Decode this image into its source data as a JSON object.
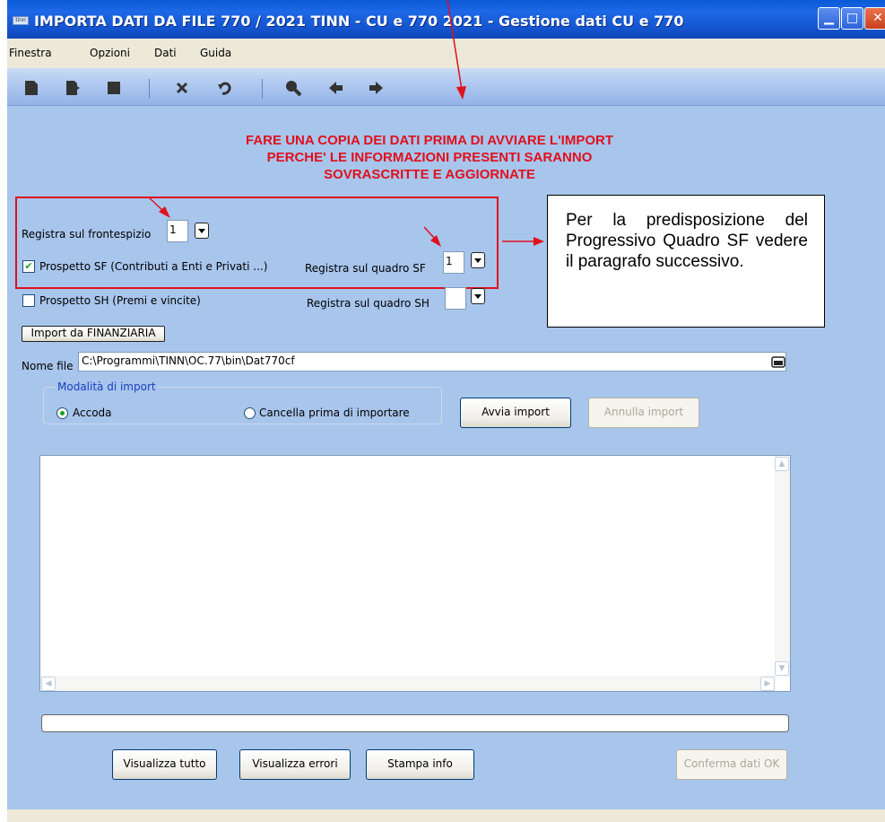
{
  "window": {
    "title": "IMPORTA DATI DA FILE 770 / 2021 TINN - CU e 770 2021 - Gestione dati CU e 770",
    "app_icon_text": "tinn",
    "minimize_glyph": "▁",
    "maximize_glyph": "□",
    "close_glyph": "✕"
  },
  "menu": {
    "items": [
      "Finestra",
      "Opzioni",
      "Dati",
      "Guida"
    ]
  },
  "toolbar": {
    "icons": [
      "new-icon",
      "open-icon",
      "save-icon",
      "delete-icon",
      "undo-icon",
      "search-icon",
      "back-icon",
      "forward-icon"
    ]
  },
  "warning": {
    "line1": "FARE UNA COPIA DEI DATI PRIMA DI AVVIARE L'IMPORT",
    "line2": "PERCHE' LE INFORMAZIONI PRESENTI SARANNO",
    "line3": "SOVRASCRITTE E AGGIORNATE",
    "color": "#e0101c"
  },
  "frontespizio": {
    "label": "Registra sul frontespizio",
    "value": "1"
  },
  "prospetto_sf": {
    "label": "Prospetto SF (Contributi a Enti e Privati ...)",
    "checked": true,
    "quadro_label": "Registra sul quadro SF",
    "quadro_value": "1"
  },
  "prospetto_sh": {
    "label": "Prospetto SH (Premi e vincite)",
    "checked": false,
    "quadro_label": "Registra sul quadro SH",
    "quadro_value": ""
  },
  "callout": {
    "text": "Per la predisposizione del Progressivo Quadro SF vedere il paragrafo successivo."
  },
  "import_finanziaria": {
    "label": "Import da FINANZIARIA"
  },
  "file": {
    "label": "Nome file",
    "value": "C:\\Programmi\\TINN\\OC.77\\bin\\Dat770cf"
  },
  "modalita": {
    "legend": "Modalità di import",
    "options": [
      {
        "label": "Accoda",
        "selected": true
      },
      {
        "label": "Cancella prima di importare",
        "selected": false
      }
    ]
  },
  "buttons": {
    "avvia": "Avvia import",
    "annulla": "Annulla import",
    "visualizza_tutto": "Visualizza tutto",
    "visualizza_errori": "Visualizza errori",
    "stampa_info": "Stampa info",
    "conferma": "Conferma dati OK"
  },
  "log": {
    "content": ""
  },
  "progress": {
    "value": 0
  }
}
